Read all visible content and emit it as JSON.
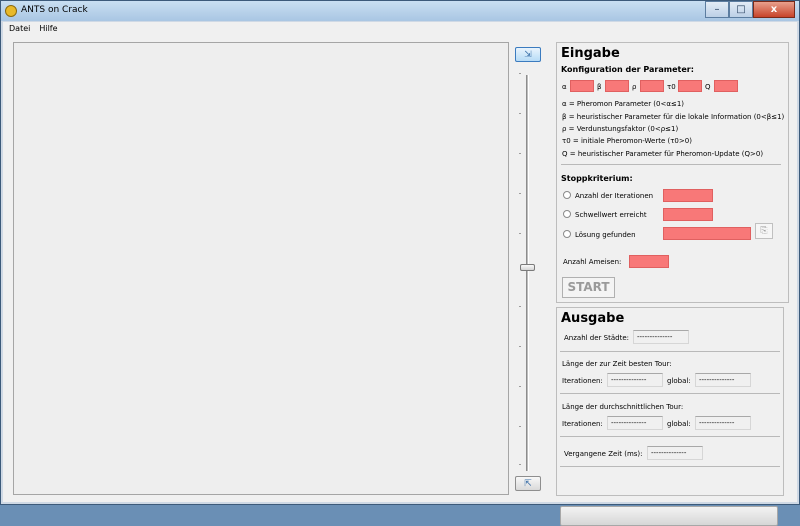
{
  "window": {
    "title": "ANTS on Crack",
    "minimize": "–",
    "maximize": "□",
    "close": "x"
  },
  "menu": [
    {
      "label": "Datei"
    },
    {
      "label": "Hilfe"
    }
  ],
  "eingabe": {
    "title": "Eingabe",
    "konfig_title": "Konfiguration der Parameter:",
    "params": [
      {
        "label": "α",
        "value": ""
      },
      {
        "label": "β",
        "value": ""
      },
      {
        "label": "ρ",
        "value": ""
      },
      {
        "label": "τ0",
        "value": ""
      },
      {
        "label": "Q",
        "value": ""
      }
    ],
    "descriptions": [
      "α = Pheromon Parameter (0<α≤1)",
      "β = heuristischer Parameter für die lokale Information (0<β≤1)",
      "ρ = Verdunstungsfaktor (0<ρ≤1)",
      "τ0 = initiale Pheromon-Werte (τ0>0)",
      "Q = heuristischer Parameter für Pheromon-Update (Q>0)"
    ],
    "stopp_title": "Stoppkriterium:",
    "stopp_options": [
      {
        "label": "Anzahl der Iterationen",
        "value": ""
      },
      {
        "label": "Schwellwert erreicht",
        "value": ""
      },
      {
        "label": "Lösung gefunden",
        "value": ""
      }
    ],
    "ameisen_label": "Anzahl Ameisen:",
    "ameisen_value": "",
    "start_label": "START"
  },
  "ausgabe": {
    "title": "Ausgabe",
    "staedte_label": "Anzahl der Städte:",
    "staedte_value": "--------------",
    "beste_title": "Länge der zur Zeit besten Tour:",
    "beste_iter_label": "Iterationen:",
    "beste_iter_value": "--------------",
    "beste_global_label": "global:",
    "beste_global_value": "--------------",
    "durch_title": "Länge der durchschnittlichen Tour:",
    "durch_iter_label": "Iterationen:",
    "durch_iter_value": "--------------",
    "durch_global_label": "global:",
    "durch_global_value": "--------------",
    "zeit_label": "Vergangene Zeit (ms):",
    "zeit_value": "--------------",
    "progress": 0
  },
  "colors": {
    "field_empty": "#f87878",
    "title_bar": "#a9c6e3"
  }
}
